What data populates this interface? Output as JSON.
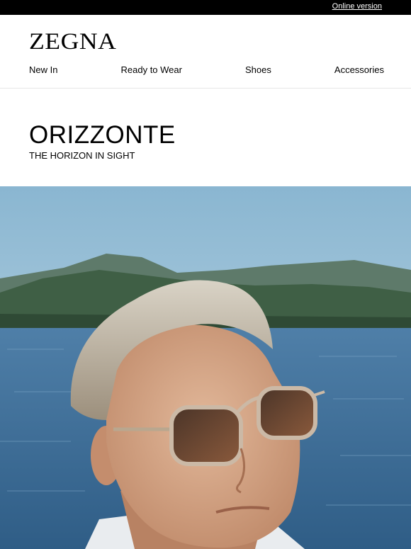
{
  "topbar": {
    "online_label": "Online version"
  },
  "header": {
    "logo": "ZEGNA",
    "nav": [
      "New In",
      "Ready to Wear",
      "Shoes",
      "Accessories"
    ]
  },
  "hero": {
    "title": "ORIZZONTE",
    "subtitle": "THE HORIZON IN SIGHT"
  },
  "colors": {
    "topbar": "#000000",
    "sky": "#9cc3d9",
    "water": "#3f6e98"
  },
  "icons": [
    "hero-photo"
  ]
}
